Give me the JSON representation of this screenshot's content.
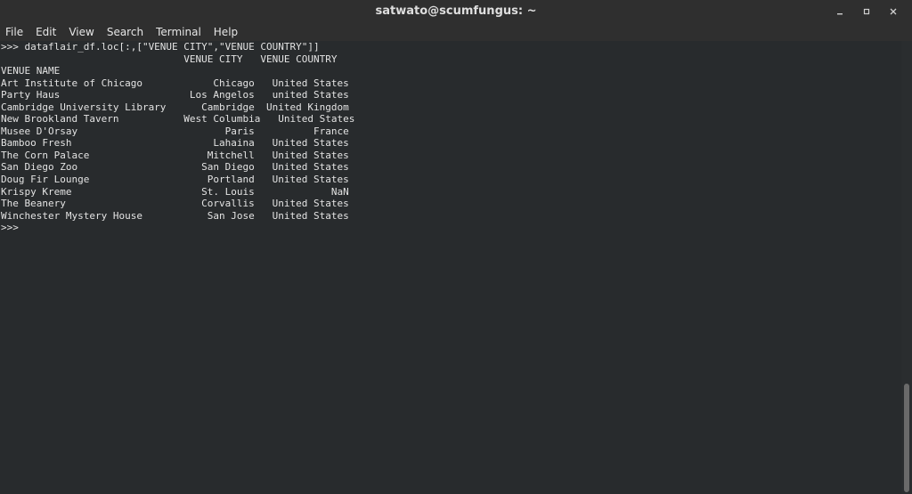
{
  "window": {
    "title": "satwato@scumfungus: ~"
  },
  "menu": {
    "items": [
      "File",
      "Edit",
      "View",
      "Search",
      "Terminal",
      "Help"
    ]
  },
  "terminal": {
    "lines": [
      ">>> dataflair_df.loc[:,[\"VENUE CITY\",\"VENUE COUNTRY\"]]",
      "                               VENUE CITY   VENUE COUNTRY",
      "VENUE NAME",
      "Art Institute of Chicago            Chicago   United States",
      "Party Haus                      Los Angelos   united States",
      "Cambridge University Library      Cambridge  United Kingdom",
      "New Brookland Tavern           West Columbia   United States",
      "Musee D'Orsay                         Paris          France",
      "Bamboo Fresh                        Lahaina   United States",
      "The Corn Palace                    Mitchell   United States",
      "San Diego Zoo                     San Diego   United States",
      "Doug Fir Lounge                    Portland   United States",
      "Krispy Kreme                      St. Louis             NaN",
      "The Beanery                       Corvallis   United States",
      "Winchester Mystery House           San Jose   United States",
      ">>>"
    ]
  }
}
